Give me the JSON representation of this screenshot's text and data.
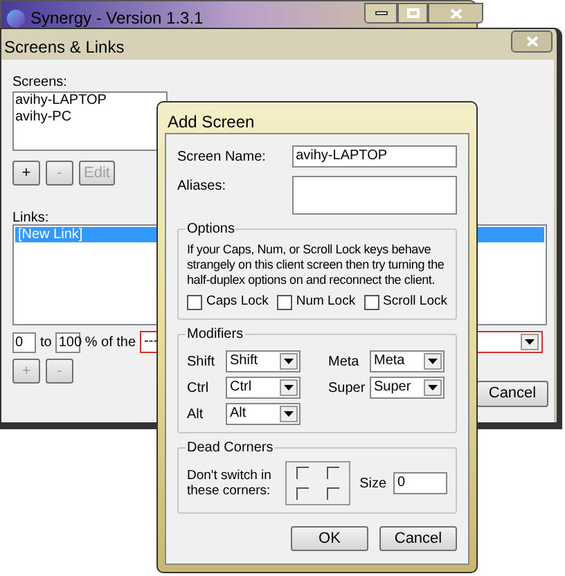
{
  "main_window": {
    "title": "Synergy - Version 1.3.1"
  },
  "screens_links": {
    "title": "Screens & Links",
    "screens_label": "Screens:",
    "screens": [
      {
        "label": "avihy-LAPTOP",
        "selected": false
      },
      {
        "label": "avihy-PC",
        "selected": false
      }
    ],
    "screen_buttons": [
      {
        "label": "+",
        "disabled": false
      },
      {
        "label": "-",
        "disabled": true
      },
      {
        "label": "Edit",
        "disabled": true
      }
    ],
    "links_label": "Links:",
    "links": [
      {
        "label": "[New Link]",
        "selected": true
      }
    ],
    "range_start": "0",
    "to_label": "to",
    "range_end": "100",
    "percent_label": "% of the",
    "target": {
      "value": "---",
      "highlighted": true
    },
    "link_buttons": [
      {
        "label": "+",
        "disabled": true
      },
      {
        "label": "-",
        "disabled": true
      }
    ],
    "cancel": "Cancel"
  },
  "add_screen": {
    "title": "Add Screen",
    "screen_name_label": "Screen Name:",
    "screen_name": "avihy-LAPTOP",
    "aliases_label": "Aliases:",
    "options": {
      "title": "Options",
      "text": "If your Caps, Num, or Scroll Lock keys behave strangely on this client screen then try turning the half-duplex options on and reconnect the client.",
      "checkboxes": [
        {
          "label": "Caps Lock",
          "checked": false
        },
        {
          "label": "Num Lock",
          "checked": false
        },
        {
          "label": "Scroll Lock",
          "checked": false
        }
      ]
    },
    "modifiers": {
      "title": "Modifiers",
      "items": [
        {
          "label": "Shift",
          "value": "Shift"
        },
        {
          "label": "Meta",
          "value": "Meta"
        },
        {
          "label": "Ctrl",
          "value": "Ctrl"
        },
        {
          "label": "Super",
          "value": "Super"
        },
        {
          "label": "Alt",
          "value": "Alt"
        }
      ]
    },
    "dead_corners": {
      "title": "Dead Corners",
      "label": "Don't switch in these corners:",
      "corners": [
        {
          "checked": false
        },
        {
          "checked": false
        },
        {
          "checked": false
        },
        {
          "checked": false
        }
      ],
      "size_label": "Size",
      "size": "0"
    },
    "buttons": [
      "OK",
      "Cancel"
    ]
  }
}
